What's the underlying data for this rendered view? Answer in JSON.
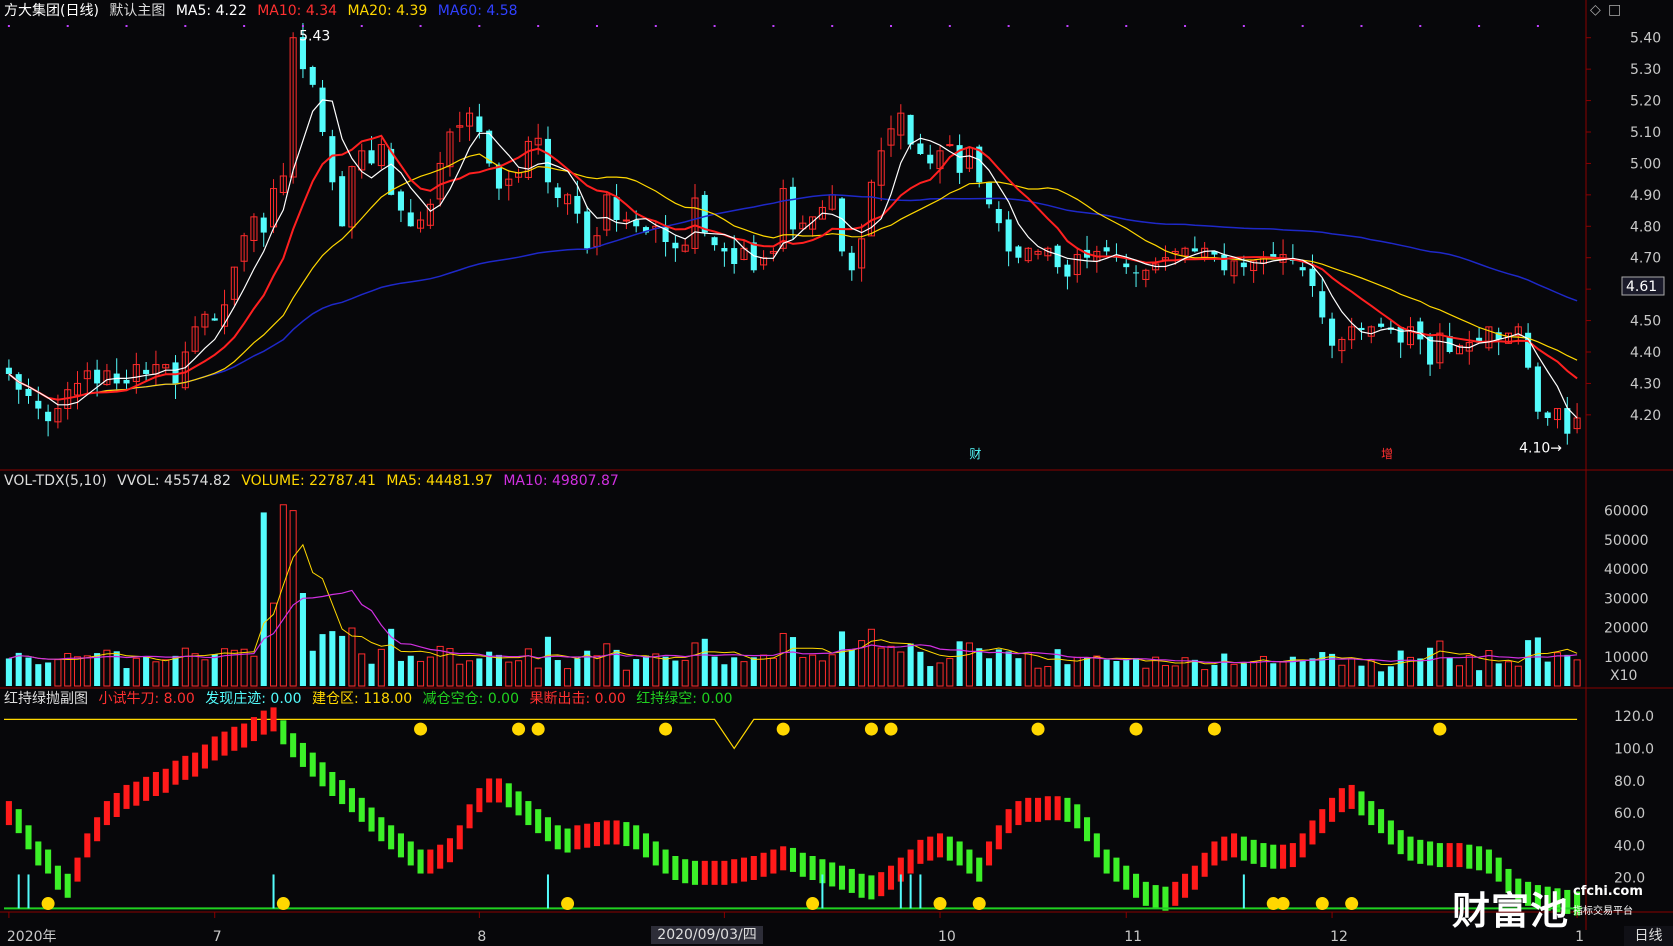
{
  "colors": {
    "up": "#ff2c2c",
    "down": "#54fcfc",
    "ma5": "#ffffff",
    "ma10": "#ff2020",
    "ma20": "#ffd700",
    "ma60": "#1e28c8",
    "vol_ma5": "#ffd700",
    "vol_ma10": "#d030e0",
    "grid": "#5a0000",
    "axis": "#c8c8c8",
    "badge": "#ffd700"
  },
  "main_header": {
    "stock": "方大集团(日线)",
    "template": "默认主图",
    "ma5": "MA5: 4.22",
    "ma10": "MA10: 4.34",
    "ma20": "MA20: 4.39",
    "ma60": "MA60: 4.58"
  },
  "vol_header": {
    "name": "VOL-TDX(5,10)",
    "vvol": "VVOL: 45574.82",
    "volume": "VOLUME: 22787.41",
    "ma5": "MA5: 44481.97",
    "ma10": "MA10: 49807.87"
  },
  "ind_header": {
    "name": "红持绿抛副图",
    "v1": "小试牛刀: 8.00",
    "v2": "发现庄迹: 0.00",
    "v3": "建仓区: 118.00",
    "v4": "减仓空仓: 0.00",
    "v5": "果断出击: 0.00",
    "v6": "红持绿空: 0.00"
  },
  "window_controls": {
    "diamond": "◇",
    "square": "□"
  },
  "current_price": "4.61",
  "annotations": {
    "high": "5.43",
    "low": "4.10",
    "tag_cai": "财",
    "tag_zeng": "增",
    "vol_unit": "X10"
  },
  "x_axis": {
    "labels": [
      "2020年",
      "7",
      "8",
      "9",
      "10",
      "11",
      "12",
      "1"
    ],
    "cursor_date": "2020/09/03/四",
    "period": "日线"
  },
  "watermark": {
    "brand": "财富池",
    "site": "cfchi.com",
    "sub": "指标交易平台"
  },
  "chart_data": [
    {
      "type": "candlestick",
      "name": "price",
      "y_ticks": [
        5.4,
        5.3,
        5.2,
        5.1,
        5.0,
        4.9,
        4.8,
        4.7,
        4.6,
        4.5,
        4.4,
        4.3,
        4.2
      ],
      "ylim": [
        4.05,
        5.45
      ],
      "close": [
        4.33,
        4.28,
        4.26,
        4.22,
        4.18,
        4.22,
        4.28,
        4.3,
        4.34,
        4.3,
        4.34,
        4.3,
        4.3,
        4.36,
        4.33,
        4.36,
        4.36,
        4.3,
        4.4,
        4.48,
        4.52,
        4.5,
        4.55,
        4.67,
        4.77,
        4.83,
        4.78,
        4.92,
        4.96,
        5.4,
        5.3,
        5.25,
        5.1,
        4.94,
        4.8,
        4.99,
        5.04,
        5.0,
        5.06,
        4.9,
        4.85,
        4.8,
        4.82,
        4.87,
        5.0,
        5.1,
        5.12,
        5.16,
        5.1,
        5.0,
        4.92,
        4.95,
        4.97,
        5.07,
        5.08,
        4.94,
        4.89,
        4.9,
        4.84,
        4.73,
        4.77,
        4.9,
        4.82,
        4.82,
        4.8,
        4.78,
        4.8,
        4.75,
        4.73,
        4.74,
        4.89,
        4.78,
        4.74,
        4.72,
        4.68,
        4.73,
        4.66,
        4.7,
        4.72,
        4.92,
        4.79,
        4.81,
        4.83,
        4.86,
        4.9,
        4.72,
        4.66,
        4.76,
        4.94,
        5.04,
        5.11,
        5.16,
        5.06,
        5.03,
        5.0,
        5.04,
        5.06,
        4.97,
        5.05,
        4.94,
        4.87,
        4.81,
        4.72,
        4.7,
        4.73,
        4.72,
        4.73,
        4.67,
        4.64,
        4.71,
        4.7,
        4.72,
        4.72,
        4.7,
        4.67,
        4.65,
        4.66,
        4.68,
        4.7,
        4.72,
        4.73,
        4.72,
        4.73,
        4.71,
        4.66,
        4.69,
        4.67,
        4.69,
        4.7,
        4.7,
        4.71,
        4.69,
        4.66,
        4.61,
        4.51,
        4.42,
        4.44,
        4.48,
        4.47,
        4.48,
        4.48,
        4.47,
        4.43,
        4.48,
        4.44,
        4.36,
        4.46,
        4.4,
        4.42,
        4.43,
        4.43,
        4.48,
        4.44,
        4.46,
        4.48,
        4.35,
        4.21,
        4.19,
        4.22,
        4.14,
        4.19
      ],
      "ma5_last": 4.22,
      "ma10_last": 4.34,
      "ma20_last": 4.39,
      "ma60_last": 4.58,
      "high_marker": 5.43,
      "low_marker": 4.1
    },
    {
      "type": "bar",
      "name": "volume",
      "y_ticks": [
        60000,
        50000,
        40000,
        30000,
        20000,
        10000
      ],
      "ylim": [
        0,
        65000
      ],
      "unit": "X10",
      "series": [
        {
          "name": "VOLUME",
          "last": 22787.41
        },
        {
          "name": "MA5",
          "last": 44481.97
        },
        {
          "name": "MA10",
          "last": 49807.87
        }
      ]
    },
    {
      "type": "bar",
      "name": "indicator",
      "y_ticks": [
        120.0,
        100.0,
        80.0,
        60.0,
        40.0,
        20.0
      ],
      "ylim": [
        0,
        130
      ],
      "values": [
        60,
        55,
        45,
        35,
        30,
        20,
        15,
        25,
        40,
        50,
        60,
        65,
        70,
        72,
        75,
        78,
        80,
        85,
        88,
        90,
        95,
        100,
        103,
        106,
        108,
        112,
        116,
        118,
        110,
        102,
        96,
        90,
        84,
        78,
        73,
        68,
        62,
        56,
        50,
        45,
        40,
        35,
        30,
        30,
        33,
        37,
        45,
        58,
        68,
        74,
        74,
        71,
        66,
        60,
        55,
        50,
        45,
        43,
        45,
        46,
        47,
        48,
        48,
        47,
        45,
        40,
        35,
        30,
        26,
        24,
        23,
        23,
        23,
        23,
        24,
        25,
        26,
        28,
        30,
        32,
        31,
        28,
        26,
        24,
        22,
        20,
        18,
        15,
        14,
        16,
        20,
        25,
        30,
        36,
        38,
        40,
        38,
        35,
        30,
        25,
        35,
        45,
        55,
        60,
        62,
        62,
        63,
        63,
        62,
        58,
        50,
        40,
        30,
        25,
        20,
        15,
        10,
        8,
        7,
        10,
        15,
        20,
        28,
        35,
        38,
        40,
        38,
        36,
        34,
        33,
        33,
        34,
        40,
        48,
        55,
        62,
        68,
        70,
        66,
        60,
        55,
        48,
        42,
        38,
        36,
        35,
        34,
        34,
        34,
        33,
        32,
        30,
        25,
        18,
        12,
        10,
        8,
        7,
        6,
        5,
        4,
        3,
        3,
        3,
        8,
        15,
        25,
        32,
        40,
        50,
        58,
        60,
        58,
        55,
        50,
        44,
        38,
        30,
        22,
        20
      ]
    }
  ]
}
